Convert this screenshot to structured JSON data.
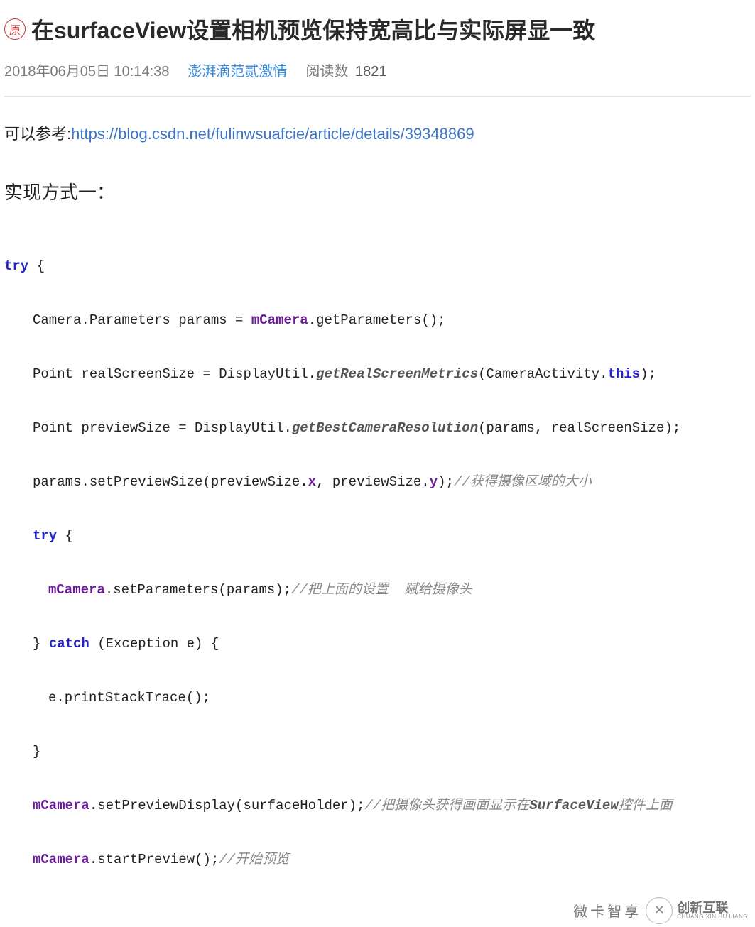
{
  "header": {
    "badge": "原",
    "title": "在surfaceView设置相机预览保持宽高比与实际屏显一致",
    "date": "2018年06月05日 10:14:38",
    "author": "澎湃滴范贰激情",
    "reads_label": "阅读数",
    "reads_count": "1821"
  },
  "body": {
    "ref_prefix": "可以参考:",
    "ref_url": "https://blog.csdn.net/fulinwsuafcie/article/details/39348869",
    "section1": "实现方式一："
  },
  "code": {
    "l1_kw": "try",
    "l1_rest": " {",
    "l2_a": "Camera.Parameters params = ",
    "l2_mem": "mCamera",
    "l2_b": ".getParameters();",
    "l3_a": "Point realScreenSize = DisplayUtil.",
    "l3_it": "getRealScreenMetrics",
    "l3_b": "(CameraActivity.",
    "l3_kw": "this",
    "l3_c": ");",
    "l4_a": "Point previewSize = DisplayUtil.",
    "l4_it": "getBestCameraResolution",
    "l4_b": "(params, realScreenSize);",
    "l5_a": "params.setPreviewSize(previewSize.",
    "l5_m1": "x",
    "l5_b": ", previewSize.",
    "l5_m2": "y",
    "l5_c": ");",
    "l5_cm": "//获得摄像区域的大小",
    "l6_kw": "try",
    "l6_rest": " {",
    "l7_mem": "mCamera",
    "l7_a": ".setParameters(params);",
    "l7_cm": "//把上面的设置  赋给摄像头",
    "l8_a": "} ",
    "l8_kw": "catch",
    "l8_b": " (Exception e) {",
    "l9": "e.printStackTrace();",
    "l10": "}",
    "l11_mem": "mCamera",
    "l11_a": ".setPreviewDisplay(surfaceHolder);",
    "l11_cm_a": "//把摄像头获得画面显示在",
    "l11_cm_it": "SurfaceView",
    "l11_cm_b": "控件上面",
    "l12_mem": "mCamera",
    "l12_a": ".startPreview();",
    "l12_cm": "//开始预览"
  },
  "watermark": {
    "text1": "微卡智享",
    "logo_glyph": "✕",
    "logo_cn": "创新互联",
    "logo_en": "CHUANG XIN HU LIANG"
  }
}
